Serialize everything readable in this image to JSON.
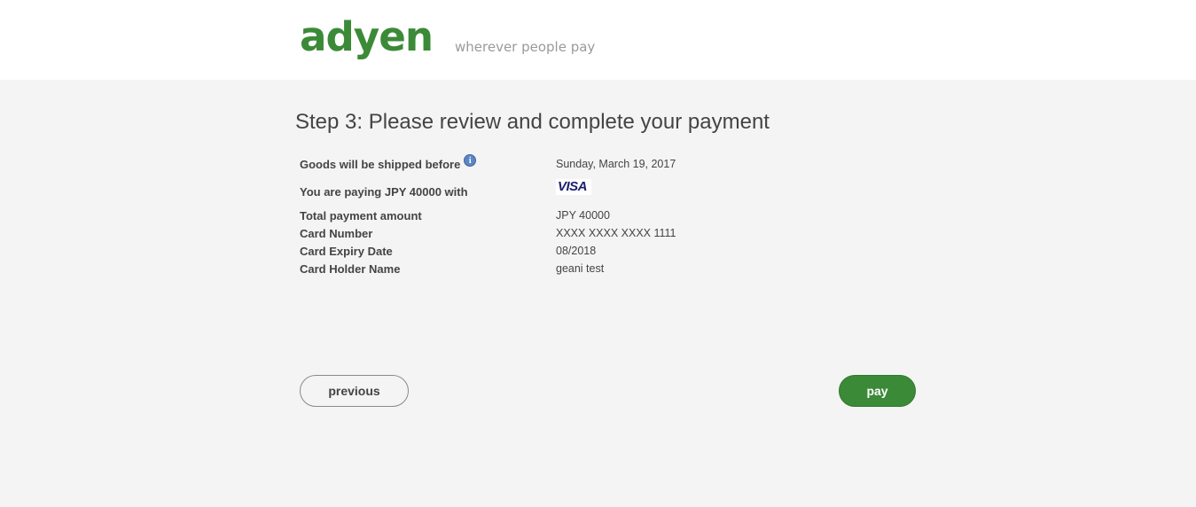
{
  "header": {
    "logo_text": "adyen",
    "tagline": "wherever people pay",
    "brand_color": "#3b8a37"
  },
  "main": {
    "title": "Step 3: Please review and complete your payment",
    "rows": [
      {
        "label": "Goods will be shipped before",
        "value": "Sunday, March 19, 2017",
        "icon": "info-icon"
      },
      {
        "label": "You are paying JPY 40000 with",
        "value": "VISA",
        "icon": "visa-logo"
      },
      {
        "label": "Total payment amount",
        "value": "JPY 40000"
      },
      {
        "label": "Card Number",
        "value": "XXXX XXXX XXXX 1111"
      },
      {
        "label": "Card Expiry Date",
        "value": "08/2018"
      },
      {
        "label": "Card Holder Name",
        "value": "geani test"
      }
    ],
    "info_icon_glyph": "i"
  },
  "buttons": {
    "previous_label": "previous",
    "pay_label": "pay",
    "pay_color": "#3b8a37"
  }
}
